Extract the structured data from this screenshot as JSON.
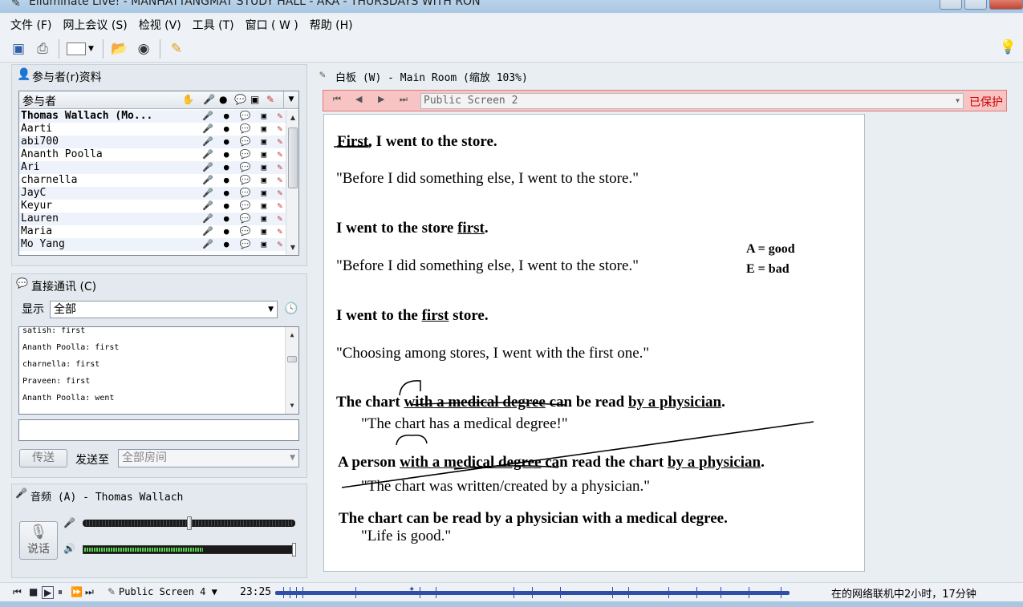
{
  "window": {
    "title": "Elluminate Live! - MANHATTANGMAT STUDY HALL - AKA - THURSDAYS WITH RON"
  },
  "menu": [
    "文件 (F)",
    "网上会议 (S)",
    "检视 (V)",
    "工具 (T)",
    "窗口 ( W )",
    "帮助 (H)"
  ],
  "participants": {
    "title": "参与者(r)资料",
    "column_header": "参与者",
    "rows": [
      "Thomas Wallach (Mo...",
      "Aarti",
      "abi700",
      "Ananth Poolla",
      "Ari",
      "charnella",
      "JayC",
      "Keyur",
      "Lauren",
      "Maria",
      "Mo Yang"
    ]
  },
  "chat": {
    "title": "直接通讯 (C)",
    "show_label": "显示",
    "show_value": "全部",
    "messages": [
      "satish: first",
      "Ananth Poolla: first",
      "charnella: first",
      "Praveen: first",
      "Ananth Poolla: went"
    ],
    "send_label": "传送",
    "send_to_label": "发送至",
    "send_to_value": "全部房间"
  },
  "audio": {
    "title": "音频 (A) - Thomas Wallach",
    "talk_label": "说话",
    "mic_level": 0.5,
    "speaker_level": 0.57
  },
  "whiteboard": {
    "title": "白板 (W) - Main Room (缩放 103%)",
    "screen_select": "Public Screen 2",
    "protected_label": "已保护",
    "lines": {
      "l1_word": "First",
      "l1_rest": ", I went to the store.",
      "l2": "\"Before I did something else, I went to the store.\"",
      "l3_pre": "I went to the store ",
      "l3_word": "first",
      "l3_post": ".",
      "l4": "\"Before I did something else, I went to the store.\"",
      "note_a": "A = good",
      "note_e": "E = bad",
      "l5_pre": "I went to the ",
      "l5_word": "first",
      "l5_post": " store.",
      "l6": "\"Choosing among stores, I went with the first one.\"",
      "l7_pre": "The chart ",
      "l7_mid": "with a medical degree",
      "l7_post": " can be read ",
      "l7_end": "by a physician",
      "l7_dot": ".",
      "l8": "\"The chart has a medical degree!\"",
      "l9_pre": "A person ",
      "l9_mid": "with a medical degree",
      "l9_post": " can read the chart ",
      "l9_end": "by a physician",
      "l9_dot": ".",
      "l10": "\"The chart was written/created by a physician.\"",
      "l11": "The chart can be read by a physician with a medical degree.",
      "l12": "\"Life is good.\""
    }
  },
  "statusbar": {
    "screen": "Public Screen 4",
    "time": "23:25",
    "online": "在的网络联机中2小时，17分钟"
  }
}
